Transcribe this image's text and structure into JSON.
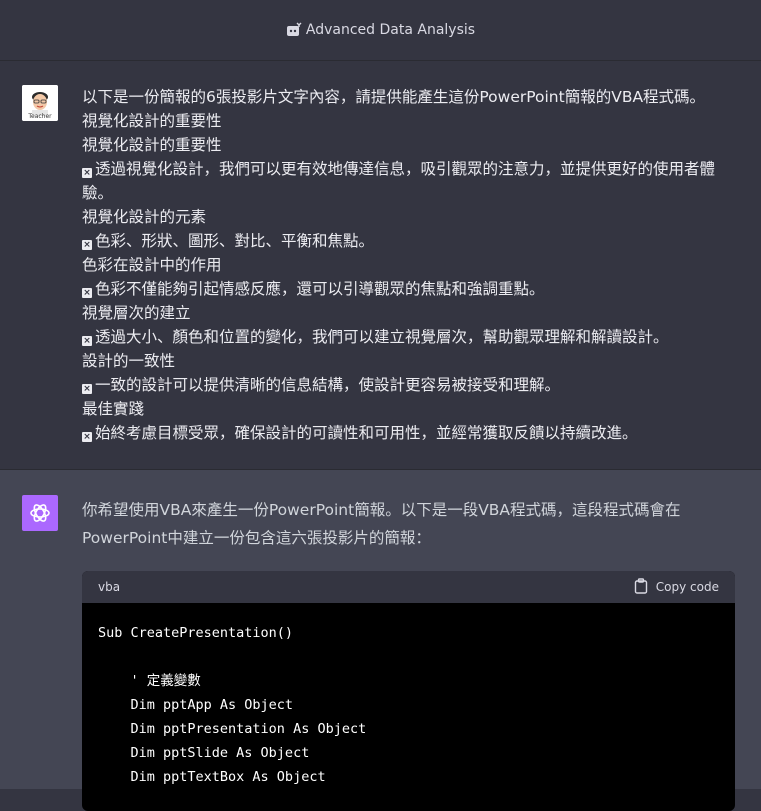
{
  "header": {
    "title": "Advanced Data Analysis",
    "icon": "plugin-icon"
  },
  "user_message": {
    "avatar_label": "Teacher",
    "lines": [
      {
        "bullet": false,
        "text": "以下是一份簡報的6張投影片文字內容，請提供能產生這份PowerPoint簡報的VBA程式碼。"
      },
      {
        "bullet": false,
        "text": "視覺化設計的重要性"
      },
      {
        "bullet": false,
        "text": "視覺化設計的重要性"
      },
      {
        "bullet": true,
        "text": "透過視覺化設計，我們可以更有效地傳達信息，吸引觀眾的注意力，並提供更好的使用者體驗。"
      },
      {
        "bullet": false,
        "text": "視覺化設計的元素"
      },
      {
        "bullet": true,
        "text": "色彩、形狀、圖形、對比、平衡和焦點。"
      },
      {
        "bullet": false,
        "text": "色彩在設計中的作用"
      },
      {
        "bullet": true,
        "text": "色彩不僅能夠引起情感反應，還可以引導觀眾的焦點和強調重點。"
      },
      {
        "bullet": false,
        "text": "視覺層次的建立"
      },
      {
        "bullet": true,
        "text": "透過大小、顏色和位置的變化，我們可以建立視覺層次，幫助觀眾理解和解讀設計。"
      },
      {
        "bullet": false,
        "text": "設計的一致性"
      },
      {
        "bullet": true,
        "text": "一致的設計可以提供清晰的信息結構，使設計更容易被接受和理解。"
      },
      {
        "bullet": false,
        "text": "最佳實踐"
      },
      {
        "bullet": true,
        "text": "始終考慮目標受眾，確保設計的可讀性和可用性，並經常獲取反饋以持續改進。"
      }
    ]
  },
  "assistant_message": {
    "text": "你希望使用VBA來產生一份PowerPoint簡報。以下是一段VBA程式碼，這段程式碼會在PowerPoint中建立一份包含這六張投影片的簡報：",
    "code": {
      "language": "vba",
      "copy_label": "Copy code",
      "lines": [
        "Sub CreatePresentation()",
        "",
        "    ' 定義變數",
        "    Dim pptApp As Object",
        "    Dim pptPresentation As Object",
        "    Dim pptSlide As Object",
        "    Dim pptTextBox As Object"
      ]
    }
  },
  "colors": {
    "background": "#343541",
    "assistant_background": "#444654",
    "gpt_avatar": "#ab68ff",
    "code_background": "#000000"
  }
}
